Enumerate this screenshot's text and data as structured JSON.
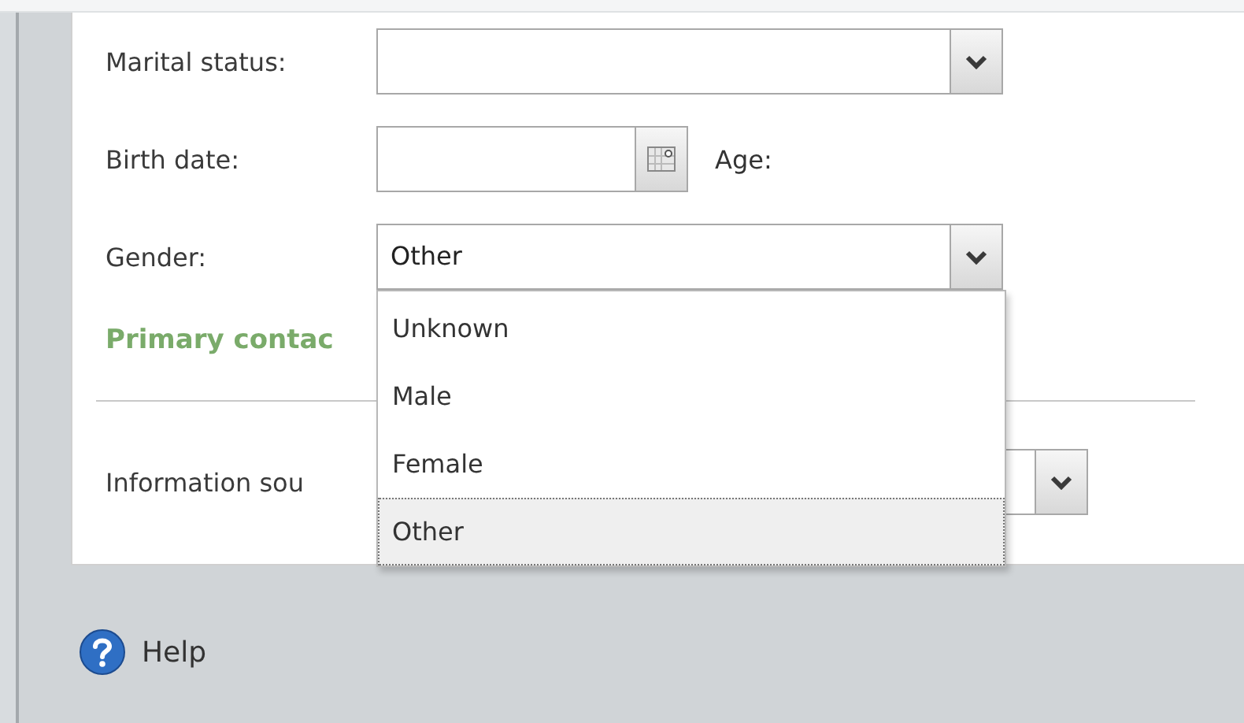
{
  "rows": [
    {
      "kind": "combo",
      "label": "Marital status:"
    },
    {
      "kind": "date",
      "label": "Birth date:",
      "after_label": "Age:"
    },
    {
      "kind": "combo",
      "label": "Gender:",
      "value": "Other",
      "expanded": true,
      "options": [
        {
          "label": "Unknown",
          "selected": false
        },
        {
          "label": "Male",
          "selected": false
        },
        {
          "label": "Female",
          "selected": false
        },
        {
          "label": "Other",
          "selected": true
        }
      ]
    },
    {
      "kind": "section",
      "title": "Primary contac"
    },
    {
      "kind": "combo",
      "label": "Information sou"
    }
  ],
  "footer": {
    "help": "Help"
  }
}
